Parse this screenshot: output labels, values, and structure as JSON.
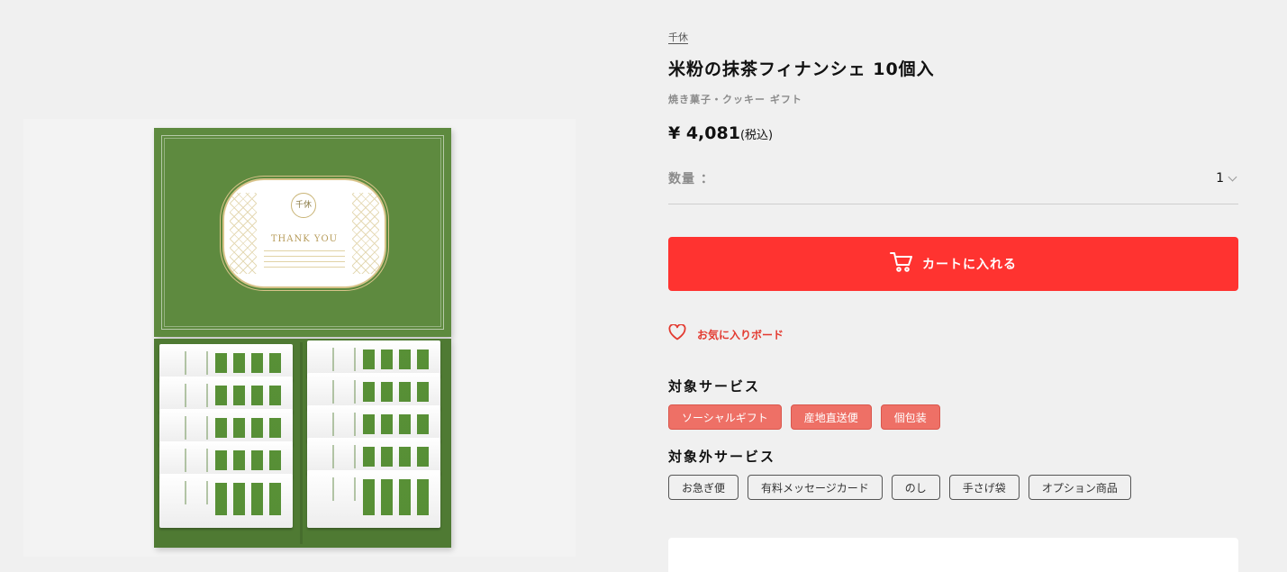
{
  "product": {
    "brand": "千休",
    "title": "米粉の抹茶フィナンシェ 10個入",
    "category": "焼き菓子・クッキー ギフト",
    "price": "¥ 4,081",
    "tax_note": "(税込)",
    "image": {
      "lid_emblem": "千休",
      "lid_text": "THANK YOU"
    }
  },
  "quantity": {
    "label": "数量 ：",
    "value": "1"
  },
  "cart_button": {
    "label": "カートに入れる",
    "icon": "cart-icon"
  },
  "favorite": {
    "label": "お気に入りボード",
    "icon": "heart-icon"
  },
  "services": {
    "included_title": "対象サービス",
    "included": [
      "ソーシャルギフト",
      "産地直送便",
      "個包装"
    ],
    "excluded_title": "対象外サービス",
    "excluded": [
      "お急ぎ便",
      "有料メッセージカード",
      "のし",
      "手さげ袋",
      "オプション商品"
    ]
  },
  "colors": {
    "accent_red": "#ff3330",
    "tag_active": "#ee7066",
    "box_green": "#5e8a3f"
  }
}
